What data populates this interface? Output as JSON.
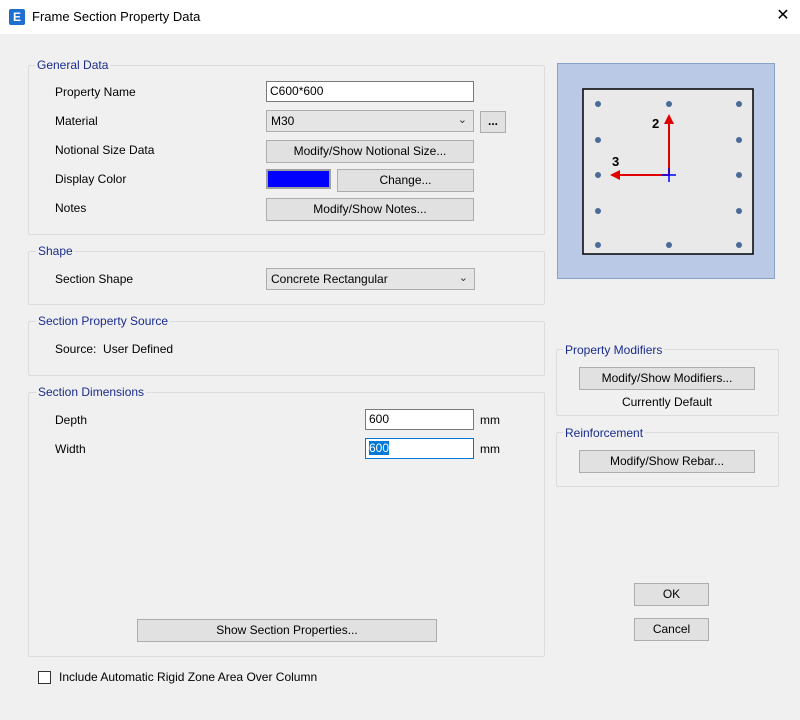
{
  "window": {
    "title": "Frame Section Property Data",
    "app_icon": "E",
    "close_glyph": "✕"
  },
  "general_data": {
    "legend": "General Data",
    "property_name_label": "Property Name",
    "property_name_value": "C600*600",
    "material_label": "Material",
    "material_value": "M30",
    "material_more_button": "...",
    "notional_size_label": "Notional Size Data",
    "notional_size_button": "Modify/Show Notional Size...",
    "display_color_label": "Display Color",
    "display_color_value": "#0000ff",
    "change_button": "Change...",
    "notes_label": "Notes",
    "notes_button": "Modify/Show Notes..."
  },
  "shape": {
    "legend": "Shape",
    "section_shape_label": "Section Shape",
    "section_shape_value": "Concrete Rectangular"
  },
  "source": {
    "legend": "Section Property Source",
    "source_text": "Source:  User Defined"
  },
  "dimensions": {
    "legend": "Section Dimensions",
    "depth_label": "Depth",
    "depth_value": "600",
    "depth_unit": "mm",
    "width_label": "Width",
    "width_value": "600",
    "width_unit": "mm",
    "show_properties_button": "Show Section Properties..."
  },
  "preview": {
    "axis_2_label": "2",
    "axis_3_label": "3"
  },
  "modifiers": {
    "legend": "Property Modifiers",
    "button": "Modify/Show Modifiers...",
    "status": "Currently Default"
  },
  "reinforcement": {
    "legend": "Reinforcement",
    "button": "Modify/Show Rebar..."
  },
  "actions": {
    "ok": "OK",
    "cancel": "Cancel"
  },
  "rigid_zone": {
    "label": "Include Automatic Rigid Zone Area Over Column",
    "checked": false
  }
}
